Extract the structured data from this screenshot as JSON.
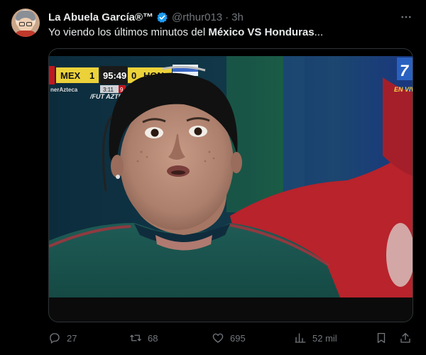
{
  "author": {
    "display_name": "La Abuela García®™",
    "handle": "@rthur013",
    "separator": "·",
    "time": "3h"
  },
  "tweet": {
    "text_prefix": "Yo viendo los últimos minutos del ",
    "text_bold": "México VS Honduras",
    "text_suffix": "..."
  },
  "media": {
    "scoreboard": {
      "team_home": "MEX",
      "score_home": "1",
      "clock": "95:49",
      "score_away": "0",
      "team_away": "HON",
      "added_time": "3:11",
      "added_red": "9",
      "network_left": "nerAzteca",
      "network_tag": "/FUT AZTECA",
      "live_label": "EN VIV"
    }
  },
  "stats": {
    "replies": "27",
    "retweets": "68",
    "likes": "695",
    "views": "52 mil"
  },
  "icons": {
    "more": "more-horizontal-icon",
    "verified": "verified-badge-icon",
    "reply": "reply-icon",
    "retweet": "retweet-icon",
    "like": "heart-icon",
    "views": "views-chart-icon",
    "bookmark": "bookmark-icon",
    "share": "share-icon"
  },
  "colors": {
    "background": "#000000",
    "text_primary": "#e7e9ea",
    "text_secondary": "#71767b",
    "verified": "#1d9bf0",
    "border": "#2f3336"
  }
}
